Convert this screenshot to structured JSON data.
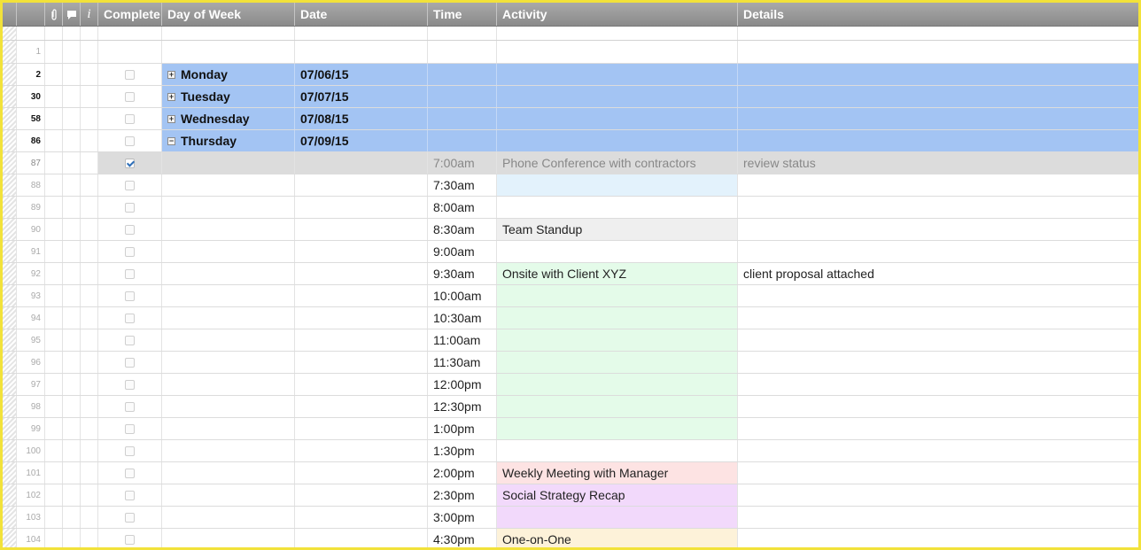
{
  "columns": {
    "attachment_icon": "paperclip-icon",
    "discussion_icon": "comment-icon",
    "info_icon": "info-icon",
    "complete": "Complete",
    "day": "Day of Week",
    "date": "Date",
    "time": "Time",
    "activity": "Activity",
    "details": "Details"
  },
  "colors": {
    "day_row": "#a3c4f3",
    "selected_row": "#dcdcdc",
    "border": "#f2e23a"
  },
  "first_row": "1",
  "day_rows": [
    {
      "num": "2",
      "day": "Monday",
      "date": "07/06/15",
      "expanded": false
    },
    {
      "num": "30",
      "day": "Tuesday",
      "date": "07/07/15",
      "expanded": false
    },
    {
      "num": "58",
      "day": "Wednesday",
      "date": "07/08/15",
      "expanded": false
    },
    {
      "num": "86",
      "day": "Thursday",
      "date": "07/09/15",
      "expanded": true
    }
  ],
  "rows": [
    {
      "num": "87",
      "checked": true,
      "time": "7:00am",
      "activity": "Phone Conference with contractors",
      "details": "review status",
      "activity_color": "",
      "selected": true
    },
    {
      "num": "88",
      "checked": false,
      "time": "7:30am",
      "activity": "",
      "details": "",
      "activity_color": "#e3f2fc"
    },
    {
      "num": "89",
      "checked": false,
      "time": "8:00am",
      "activity": "",
      "details": "",
      "activity_color": ""
    },
    {
      "num": "90",
      "checked": false,
      "time": "8:30am",
      "activity": "Team Standup",
      "details": "",
      "activity_color": "#efefef"
    },
    {
      "num": "91",
      "checked": false,
      "time": "9:00am",
      "activity": "",
      "details": "",
      "activity_color": ""
    },
    {
      "num": "92",
      "checked": false,
      "time": "9:30am",
      "activity": "Onsite with Client XYZ",
      "details": "client proposal attached",
      "activity_color": "#e4fbe9"
    },
    {
      "num": "93",
      "checked": false,
      "time": "10:00am",
      "activity": "",
      "details": "",
      "activity_color": "#e4fbe9"
    },
    {
      "num": "94",
      "checked": false,
      "time": "10:30am",
      "activity": "",
      "details": "",
      "activity_color": "#e4fbe9"
    },
    {
      "num": "95",
      "checked": false,
      "time": "11:00am",
      "activity": "",
      "details": "",
      "activity_color": "#e4fbe9"
    },
    {
      "num": "96",
      "checked": false,
      "time": "11:30am",
      "activity": "",
      "details": "",
      "activity_color": "#e4fbe9"
    },
    {
      "num": "97",
      "checked": false,
      "time": "12:00pm",
      "activity": "",
      "details": "",
      "activity_color": "#e4fbe9"
    },
    {
      "num": "98",
      "checked": false,
      "time": "12:30pm",
      "activity": "",
      "details": "",
      "activity_color": "#e4fbe9"
    },
    {
      "num": "99",
      "checked": false,
      "time": "1:00pm",
      "activity": "",
      "details": "",
      "activity_color": "#e4fbe9"
    },
    {
      "num": "100",
      "checked": false,
      "time": "1:30pm",
      "activity": "",
      "details": "",
      "activity_color": ""
    },
    {
      "num": "101",
      "checked": false,
      "time": "2:00pm",
      "activity": "Weekly Meeting with Manager",
      "details": "",
      "activity_color": "#fde3e3"
    },
    {
      "num": "102",
      "checked": false,
      "time": "2:30pm",
      "activity": "Social Strategy Recap",
      "details": "",
      "activity_color": "#f2d9fb"
    },
    {
      "num": "103",
      "checked": false,
      "time": "3:00pm",
      "activity": "",
      "details": "",
      "activity_color": "#f2d9fb"
    },
    {
      "num": "104",
      "checked": false,
      "time": "4:30pm",
      "activity": "One-on-One",
      "details": "",
      "activity_color": "#fdf2d9"
    }
  ]
}
